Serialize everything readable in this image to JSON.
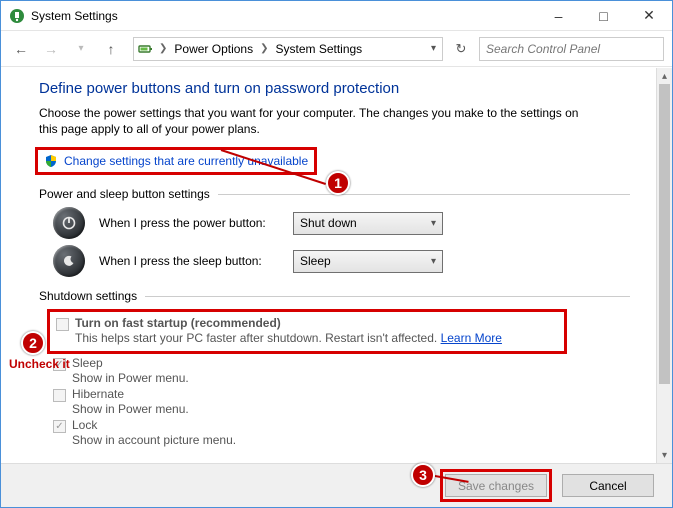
{
  "window": {
    "title": "System Settings"
  },
  "breadcrumb": {
    "items": [
      "Power Options",
      "System Settings"
    ]
  },
  "search": {
    "placeholder": "Search Control Panel"
  },
  "page": {
    "title": "Define power buttons and turn on password protection",
    "description": "Choose the power settings that you want for your computer. The changes you make to the settings on this page apply to all of your power plans.",
    "change_link": "Change settings that are currently unavailable"
  },
  "power_sleep": {
    "section": "Power and sleep button settings",
    "power_label": "When I press the power button:",
    "power_value": "Shut down",
    "sleep_label": "When I press the sleep button:",
    "sleep_value": "Sleep"
  },
  "shutdown": {
    "section": "Shutdown settings",
    "fast": {
      "title": "Turn on fast startup (recommended)",
      "desc": "This helps start your PC faster after shutdown. Restart isn't affected. ",
      "learn": "Learn More"
    },
    "sleep": {
      "title": "Sleep",
      "desc": "Show in Power menu."
    },
    "hibernate": {
      "title": "Hibernate",
      "desc": "Show in Power menu."
    },
    "lock": {
      "title": "Lock",
      "desc": "Show in account picture menu."
    }
  },
  "footer": {
    "save": "Save changes",
    "cancel": "Cancel"
  },
  "annotations": {
    "uncheck": "Uncheck it"
  }
}
